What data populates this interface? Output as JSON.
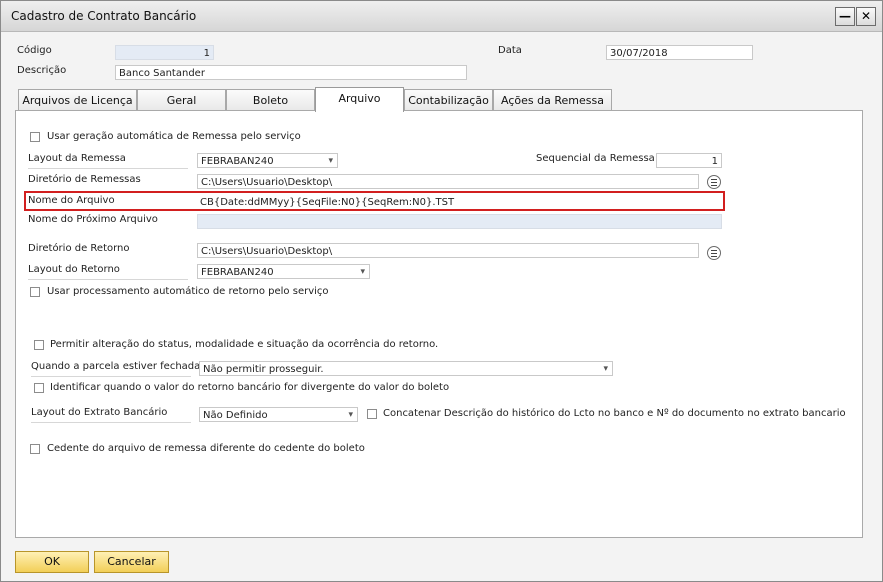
{
  "window": {
    "title": "Cadastro de Contrato Bancário"
  },
  "header": {
    "codigo_label": "Código",
    "codigo_value": "1",
    "descricao_label": "Descrição",
    "descricao_value": "Banco Santander",
    "data_label": "Data",
    "data_value": "30/07/2018"
  },
  "tabs": [
    {
      "label": "Arquivos de Licença"
    },
    {
      "label": "Geral"
    },
    {
      "label": "Boleto"
    },
    {
      "label": "Arquivo"
    },
    {
      "label": "Contabilização"
    },
    {
      "label": "Ações da Remessa"
    }
  ],
  "active_tab": "Arquivo",
  "arquivo": {
    "auto_remessa_label": "Usar geração automática de Remessa pelo serviço",
    "auto_remessa_checked": false,
    "layout_remessa_label": "Layout da Remessa",
    "layout_remessa_value": "FEBRABAN240",
    "sequencial_label": "Sequencial da Remessa",
    "sequencial_value": "1",
    "dir_remessas_label": "Diretório de Remessas",
    "dir_remessas_value": "C:\\Users\\Usuario\\Desktop\\",
    "nome_arquivo_label": "Nome do Arquivo",
    "nome_arquivo_value": "CB{Date:ddMMyy}{SeqFile:N0}{SeqRem:N0}.TST",
    "nome_proximo_label": "Nome do Próximo Arquivo",
    "nome_proximo_value": "",
    "dir_retorno_label": "Diretório de Retorno",
    "dir_retorno_value": "C:\\Users\\Usuario\\Desktop\\",
    "layout_retorno_label": "Layout do Retorno",
    "layout_retorno_value": "FEBRABAN240",
    "auto_retorno_label": "Usar processamento automático de retorno pelo serviço",
    "auto_retorno_checked": false,
    "permitir_alteracao_label": "Permitir alteração do status, modalidade e situação da ocorrência do retorno.",
    "permitir_alteracao_checked": false,
    "parcela_fechada_label": "Quando a parcela estiver fechada",
    "parcela_fechada_value": "Não permitir prosseguir.",
    "identificar_divergente_label": "Identificar quando o valor do retorno bancário for divergente do valor do boleto",
    "identificar_divergente_checked": false,
    "layout_extrato_label": "Layout do Extrato Bancário",
    "layout_extrato_value": "Não Definido",
    "concatenar_label": "Concatenar Descrição do histórico do Lcto no banco e Nº do documento no extrato bancario",
    "concatenar_checked": false,
    "cedente_label": "Cedente do arquivo de remessa diferente do cedente do boleto",
    "cedente_checked": false
  },
  "footer": {
    "ok_label": "OK",
    "cancel_label": "Cancelar"
  },
  "colors": {
    "highlight": "#d21f1f",
    "button_accent": "#f2cf58",
    "readonly_field": "#e4ebf5"
  },
  "icons": {
    "browse": "list-icon",
    "minimize": "minimize-icon",
    "close": "close-icon"
  }
}
